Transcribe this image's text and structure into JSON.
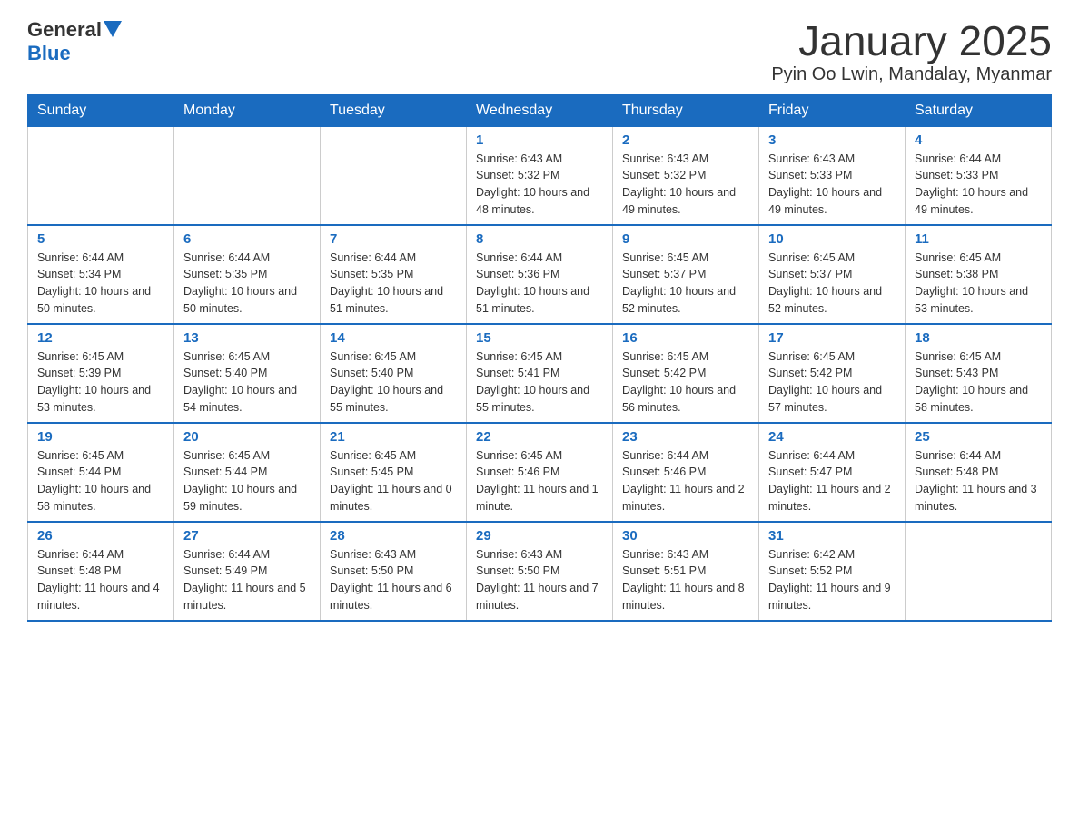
{
  "logo": {
    "general": "General",
    "blue": "Blue"
  },
  "title": "January 2025",
  "subtitle": "Pyin Oo Lwin, Mandalay, Myanmar",
  "days_header": [
    "Sunday",
    "Monday",
    "Tuesday",
    "Wednesday",
    "Thursday",
    "Friday",
    "Saturday"
  ],
  "weeks": [
    [
      {
        "day": "",
        "info": ""
      },
      {
        "day": "",
        "info": ""
      },
      {
        "day": "",
        "info": ""
      },
      {
        "day": "1",
        "info": "Sunrise: 6:43 AM\nSunset: 5:32 PM\nDaylight: 10 hours and 48 minutes."
      },
      {
        "day": "2",
        "info": "Sunrise: 6:43 AM\nSunset: 5:32 PM\nDaylight: 10 hours and 49 minutes."
      },
      {
        "day": "3",
        "info": "Sunrise: 6:43 AM\nSunset: 5:33 PM\nDaylight: 10 hours and 49 minutes."
      },
      {
        "day": "4",
        "info": "Sunrise: 6:44 AM\nSunset: 5:33 PM\nDaylight: 10 hours and 49 minutes."
      }
    ],
    [
      {
        "day": "5",
        "info": "Sunrise: 6:44 AM\nSunset: 5:34 PM\nDaylight: 10 hours and 50 minutes."
      },
      {
        "day": "6",
        "info": "Sunrise: 6:44 AM\nSunset: 5:35 PM\nDaylight: 10 hours and 50 minutes."
      },
      {
        "day": "7",
        "info": "Sunrise: 6:44 AM\nSunset: 5:35 PM\nDaylight: 10 hours and 51 minutes."
      },
      {
        "day": "8",
        "info": "Sunrise: 6:44 AM\nSunset: 5:36 PM\nDaylight: 10 hours and 51 minutes."
      },
      {
        "day": "9",
        "info": "Sunrise: 6:45 AM\nSunset: 5:37 PM\nDaylight: 10 hours and 52 minutes."
      },
      {
        "day": "10",
        "info": "Sunrise: 6:45 AM\nSunset: 5:37 PM\nDaylight: 10 hours and 52 minutes."
      },
      {
        "day": "11",
        "info": "Sunrise: 6:45 AM\nSunset: 5:38 PM\nDaylight: 10 hours and 53 minutes."
      }
    ],
    [
      {
        "day": "12",
        "info": "Sunrise: 6:45 AM\nSunset: 5:39 PM\nDaylight: 10 hours and 53 minutes."
      },
      {
        "day": "13",
        "info": "Sunrise: 6:45 AM\nSunset: 5:40 PM\nDaylight: 10 hours and 54 minutes."
      },
      {
        "day": "14",
        "info": "Sunrise: 6:45 AM\nSunset: 5:40 PM\nDaylight: 10 hours and 55 minutes."
      },
      {
        "day": "15",
        "info": "Sunrise: 6:45 AM\nSunset: 5:41 PM\nDaylight: 10 hours and 55 minutes."
      },
      {
        "day": "16",
        "info": "Sunrise: 6:45 AM\nSunset: 5:42 PM\nDaylight: 10 hours and 56 minutes."
      },
      {
        "day": "17",
        "info": "Sunrise: 6:45 AM\nSunset: 5:42 PM\nDaylight: 10 hours and 57 minutes."
      },
      {
        "day": "18",
        "info": "Sunrise: 6:45 AM\nSunset: 5:43 PM\nDaylight: 10 hours and 58 minutes."
      }
    ],
    [
      {
        "day": "19",
        "info": "Sunrise: 6:45 AM\nSunset: 5:44 PM\nDaylight: 10 hours and 58 minutes."
      },
      {
        "day": "20",
        "info": "Sunrise: 6:45 AM\nSunset: 5:44 PM\nDaylight: 10 hours and 59 minutes."
      },
      {
        "day": "21",
        "info": "Sunrise: 6:45 AM\nSunset: 5:45 PM\nDaylight: 11 hours and 0 minutes."
      },
      {
        "day": "22",
        "info": "Sunrise: 6:45 AM\nSunset: 5:46 PM\nDaylight: 11 hours and 1 minute."
      },
      {
        "day": "23",
        "info": "Sunrise: 6:44 AM\nSunset: 5:46 PM\nDaylight: 11 hours and 2 minutes."
      },
      {
        "day": "24",
        "info": "Sunrise: 6:44 AM\nSunset: 5:47 PM\nDaylight: 11 hours and 2 minutes."
      },
      {
        "day": "25",
        "info": "Sunrise: 6:44 AM\nSunset: 5:48 PM\nDaylight: 11 hours and 3 minutes."
      }
    ],
    [
      {
        "day": "26",
        "info": "Sunrise: 6:44 AM\nSunset: 5:48 PM\nDaylight: 11 hours and 4 minutes."
      },
      {
        "day": "27",
        "info": "Sunrise: 6:44 AM\nSunset: 5:49 PM\nDaylight: 11 hours and 5 minutes."
      },
      {
        "day": "28",
        "info": "Sunrise: 6:43 AM\nSunset: 5:50 PM\nDaylight: 11 hours and 6 minutes."
      },
      {
        "day": "29",
        "info": "Sunrise: 6:43 AM\nSunset: 5:50 PM\nDaylight: 11 hours and 7 minutes."
      },
      {
        "day": "30",
        "info": "Sunrise: 6:43 AM\nSunset: 5:51 PM\nDaylight: 11 hours and 8 minutes."
      },
      {
        "day": "31",
        "info": "Sunrise: 6:42 AM\nSunset: 5:52 PM\nDaylight: 11 hours and 9 minutes."
      },
      {
        "day": "",
        "info": ""
      }
    ]
  ]
}
